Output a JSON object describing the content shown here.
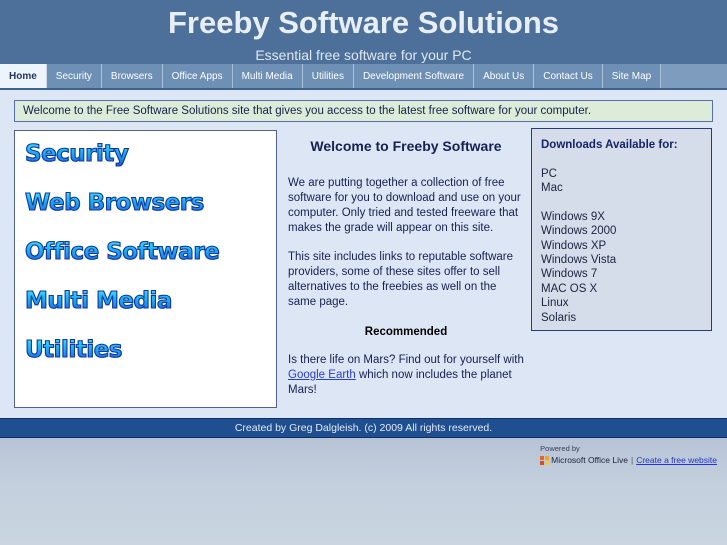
{
  "header": {
    "title": "Freeby Software Solutions",
    "tagline": "Essential free software for your PC",
    "bg_color": "#4c7099"
  },
  "nav": {
    "items": [
      {
        "label": "Home",
        "active": true
      },
      {
        "label": "Security",
        "active": false
      },
      {
        "label": "Browsers",
        "active": false
      },
      {
        "label": "Office Apps",
        "active": false
      },
      {
        "label": "Multi Media",
        "active": false
      },
      {
        "label": "Utilities",
        "active": false
      },
      {
        "label": "Development Software",
        "active": false
      },
      {
        "label": "About Us",
        "active": false
      },
      {
        "label": "Contact Us",
        "active": false
      },
      {
        "label": "Site Map",
        "active": false
      }
    ]
  },
  "banner": {
    "text": "Welcome to the Free Software Solutions site that gives you access to the latest free software for your computer.",
    "bg_color": "#dcecd9",
    "border_color": "#5a6fa8"
  },
  "left_box": {
    "categories": [
      {
        "label": "Security"
      },
      {
        "label": "Web Browsers"
      },
      {
        "label": "Office Software"
      },
      {
        "label": "Multi Media"
      },
      {
        "label": "Utilities"
      }
    ],
    "gradient_top": "#5fe6fb",
    "gradient_bottom": "#1440c8",
    "outline_color": "#14379c"
  },
  "main": {
    "heading": "Welcome to Freeby Software",
    "paragraph1": "We are putting together a collection of free software for you to download and use on your computer.  Only tried and tested freeware that makes the grade will appear on this site.",
    "paragraph2": "This site includes links to reputable software providers, some of these sites offer to sell alternatives to the freebies as well on the same page.",
    "recommended_heading": "Recommended",
    "recommend_prefix": "Is there life on Mars?  Find out for yourself with ",
    "recommend_link": "Google Earth",
    "recommend_suffix": " which now includes the planet Mars!",
    "link_color": "#2a3ed0"
  },
  "right_box": {
    "title": "Downloads Available for:",
    "group1": [
      "PC",
      "Mac"
    ],
    "group2": [
      "Windows 9X",
      "Windows 2000",
      "Windows XP",
      "Windows Vista",
      "Windows 7",
      "MAC OS X",
      "Linux",
      "Solaris"
    ],
    "bg_color": "#d5ddea",
    "border_color": "#283a78"
  },
  "footer": {
    "copyright": "Created by Greg Dalgleish. (c) 2009 All rights reserved.",
    "bar_color": "#1f4e91",
    "powered_by_label": "Powered by",
    "powered_by_brand": "Microsoft Office Live",
    "separator": "|",
    "create_site_link": "Create a free website"
  }
}
